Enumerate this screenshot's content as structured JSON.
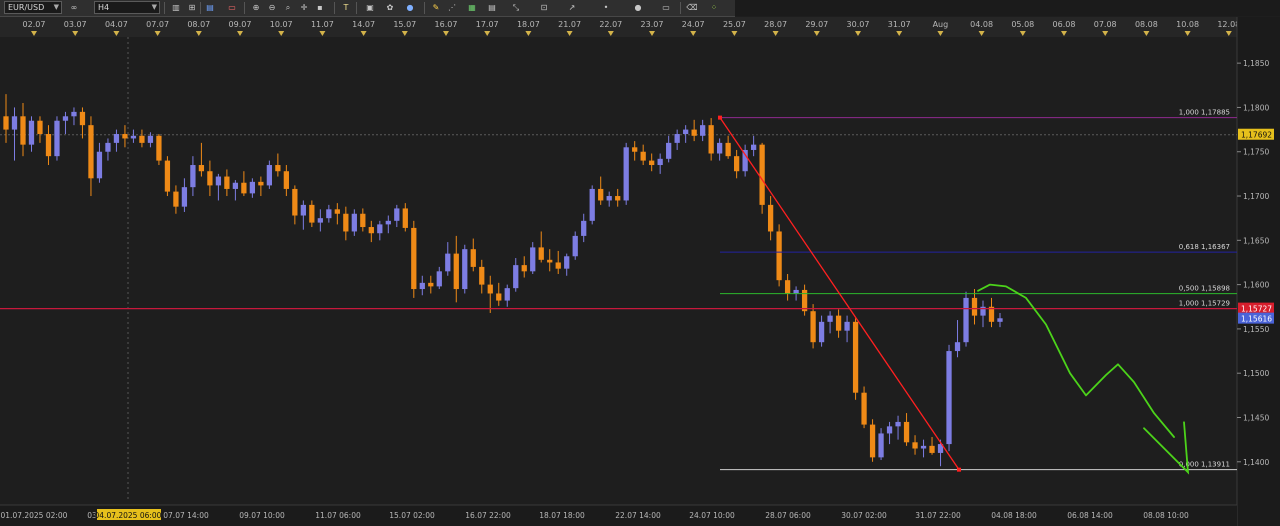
{
  "toolbar": {
    "symbol": "EUR/USD",
    "timeframe": "H4",
    "icons": [
      "link-icon",
      "candles-icon",
      "bars-icon",
      "line-chart-icon",
      "zoom-in-icon",
      "zoom-out-icon",
      "search-icon",
      "crosshair-icon",
      "cursor-icon",
      "text-tool-icon",
      "note-icon",
      "color-palette-icon",
      "globe-icon",
      "pencil-icon",
      "trend-tool-icon",
      "window-icon",
      "fibonacci-icon",
      "shapes-icon",
      "channel-icon",
      "sphere-icon",
      "arrow-icon",
      "eraser-icon",
      "indicators-icon"
    ]
  },
  "chart": {
    "colors": {
      "background": "#1e1e1e",
      "bull": "#7d7de3",
      "bear": "#ef8a17",
      "trend_line": "#ff2020",
      "support_line": "#c8193c",
      "green_drawing": "#4cd31a",
      "fib_1": "#8e2a8e",
      "fib_0618": "#2323a0",
      "fib_0500": "#2cb82c",
      "fib_0": "#cfcfcf"
    },
    "top_dates": [
      "02.07",
      "03.07",
      "04.07",
      "07.07",
      "08.07",
      "09.07",
      "10.07",
      "11.07",
      "14.07",
      "15.07",
      "16.07",
      "17.07",
      "18.07",
      "21.07",
      "22.07",
      "23.07",
      "24.07",
      "25.07",
      "28.07",
      "29.07",
      "30.07",
      "31.07",
      "Aug",
      "04.08",
      "05.08",
      "06.08",
      "07.08",
      "08.08",
      "10.08",
      "12.08"
    ],
    "bottom_dates": [
      "01.07.2025 02:00",
      "03",
      "04.07.2025 06:00",
      "07.07 14:00",
      "09.07 10:00",
      "11.07 06:00",
      "15.07 02:00",
      "16.07 22:00",
      "18.07 18:00",
      "22.07 14:00",
      "24.07 10:00",
      "28.07 06:00",
      "30.07 02:00",
      "31.07 22:00",
      "04.08 18:00",
      "06.08 14:00",
      "08.08 10:00"
    ],
    "price_labels": [
      "1,18500",
      "1,1800",
      "1,1750",
      "1,1700",
      "1,1650",
      "1,1600",
      "1,1550",
      "1,1500",
      "1,1450",
      "1,1400",
      "1,1850"
    ],
    "y_axis": [
      "1,1850",
      "1,1800",
      "1,1750",
      "1,1700",
      "1,1650",
      "1,1600",
      "1,1550",
      "1,1500",
      "1,1450",
      "1,1400"
    ],
    "price_tags": {
      "high_marker": "1,17692",
      "line_price": "1,15727",
      "current_price": "1,15616"
    },
    "fib_levels": [
      {
        "label": "1,000 1,17885",
        "price": 1.17885
      },
      {
        "label": "0,618 1,16367",
        "price": 1.16367
      },
      {
        "label": "0,500 1,15898",
        "price": 1.15898
      },
      {
        "label": "0,000 1,13911",
        "price": 1.13911
      }
    ],
    "support_label": "1,000 1,15729",
    "support_price": 1.15729,
    "high_marker_price": 1.17692,
    "current_price": 1.15616,
    "candles": [
      [
        1.179,
        1.1815,
        1.176,
        1.1775
      ],
      [
        1.1775,
        1.18,
        1.174,
        1.179
      ],
      [
        1.179,
        1.1805,
        1.1745,
        1.1758
      ],
      [
        1.1758,
        1.179,
        1.175,
        1.1785
      ],
      [
        1.1785,
        1.179,
        1.176,
        1.177
      ],
      [
        1.177,
        1.178,
        1.1735,
        1.1745
      ],
      [
        1.1745,
        1.179,
        1.174,
        1.1785
      ],
      [
        1.1785,
        1.1795,
        1.177,
        1.179
      ],
      [
        1.179,
        1.18,
        1.178,
        1.1795
      ],
      [
        1.1795,
        1.18,
        1.1765,
        1.178
      ],
      [
        1.178,
        1.179,
        1.17,
        1.172
      ],
      [
        1.172,
        1.176,
        1.1715,
        1.175
      ],
      [
        1.175,
        1.1765,
        1.174,
        1.176
      ],
      [
        1.176,
        1.1775,
        1.175,
        1.177
      ],
      [
        1.177,
        1.178,
        1.1755,
        1.1765
      ],
      [
        1.1765,
        1.1775,
        1.176,
        1.1768
      ],
      [
        1.1768,
        1.1775,
        1.1755,
        1.176
      ],
      [
        1.176,
        1.1772,
        1.1755,
        1.1768
      ],
      [
        1.1768,
        1.177,
        1.1735,
        1.174
      ],
      [
        1.174,
        1.1745,
        1.17,
        1.1705
      ],
      [
        1.1705,
        1.1712,
        1.168,
        1.1688
      ],
      [
        1.1688,
        1.172,
        1.1682,
        1.171
      ],
      [
        1.171,
        1.1745,
        1.17,
        1.1735
      ],
      [
        1.1735,
        1.176,
        1.1722,
        1.1728
      ],
      [
        1.1728,
        1.174,
        1.17,
        1.1712
      ],
      [
        1.1712,
        1.1725,
        1.1695,
        1.1722
      ],
      [
        1.1722,
        1.173,
        1.17,
        1.1708
      ],
      [
        1.1708,
        1.1718,
        1.1695,
        1.1715
      ],
      [
        1.1715,
        1.1728,
        1.17,
        1.1703
      ],
      [
        1.1703,
        1.172,
        1.1698,
        1.1716
      ],
      [
        1.1716,
        1.1722,
        1.17,
        1.1712
      ],
      [
        1.1712,
        1.174,
        1.1708,
        1.1735
      ],
      [
        1.1735,
        1.1748,
        1.1722,
        1.1728
      ],
      [
        1.1728,
        1.1735,
        1.17,
        1.1708
      ],
      [
        1.1708,
        1.1712,
        1.1668,
        1.1678
      ],
      [
        1.1678,
        1.1695,
        1.1662,
        1.169
      ],
      [
        1.169,
        1.1695,
        1.1665,
        1.167
      ],
      [
        1.167,
        1.1685,
        1.166,
        1.1675
      ],
      [
        1.1675,
        1.169,
        1.167,
        1.1685
      ],
      [
        1.1685,
        1.1692,
        1.1668,
        1.168
      ],
      [
        1.168,
        1.1688,
        1.165,
        1.166
      ],
      [
        1.166,
        1.1685,
        1.1655,
        1.168
      ],
      [
        1.168,
        1.1686,
        1.166,
        1.1665
      ],
      [
        1.1665,
        1.1672,
        1.1648,
        1.1658
      ],
      [
        1.1658,
        1.1672,
        1.165,
        1.1668
      ],
      [
        1.1668,
        1.1678,
        1.1658,
        1.1672
      ],
      [
        1.1672,
        1.169,
        1.1665,
        1.1686
      ],
      [
        1.1686,
        1.1692,
        1.166,
        1.1664
      ],
      [
        1.1664,
        1.1672,
        1.1585,
        1.1595
      ],
      [
        1.1595,
        1.161,
        1.1588,
        1.1602
      ],
      [
        1.1602,
        1.161,
        1.159,
        1.1598
      ],
      [
        1.1598,
        1.162,
        1.1595,
        1.1615
      ],
      [
        1.1615,
        1.1648,
        1.161,
        1.1635
      ],
      [
        1.1635,
        1.1655,
        1.158,
        1.1595
      ],
      [
        1.1595,
        1.1645,
        1.159,
        1.164
      ],
      [
        1.164,
        1.1652,
        1.1615,
        1.162
      ],
      [
        1.162,
        1.1628,
        1.159,
        1.16
      ],
      [
        1.16,
        1.161,
        1.1568,
        1.159
      ],
      [
        1.159,
        1.1602,
        1.1576,
        1.1582
      ],
      [
        1.1582,
        1.16,
        1.1575,
        1.1596
      ],
      [
        1.1596,
        1.163,
        1.1592,
        1.1622
      ],
      [
        1.1622,
        1.1632,
        1.1608,
        1.1615
      ],
      [
        1.1615,
        1.1648,
        1.1612,
        1.1642
      ],
      [
        1.1642,
        1.166,
        1.1625,
        1.1628
      ],
      [
        1.1628,
        1.164,
        1.1615,
        1.1625
      ],
      [
        1.1625,
        1.1638,
        1.1612,
        1.1618
      ],
      [
        1.1618,
        1.1635,
        1.161,
        1.1632
      ],
      [
        1.1632,
        1.166,
        1.1628,
        1.1655
      ],
      [
        1.1655,
        1.168,
        1.1648,
        1.1672
      ],
      [
        1.1672,
        1.1712,
        1.1668,
        1.1708
      ],
      [
        1.1708,
        1.1722,
        1.169,
        1.1695
      ],
      [
        1.1695,
        1.1705,
        1.1688,
        1.17
      ],
      [
        1.17,
        1.1708,
        1.1688,
        1.1695
      ],
      [
        1.1695,
        1.176,
        1.169,
        1.1755
      ],
      [
        1.1755,
        1.1762,
        1.174,
        1.175
      ],
      [
        1.175,
        1.1758,
        1.1735,
        1.174
      ],
      [
        1.174,
        1.1748,
        1.1728,
        1.1735
      ],
      [
        1.1735,
        1.1748,
        1.1725,
        1.1742
      ],
      [
        1.1742,
        1.1768,
        1.1738,
        1.176
      ],
      [
        1.176,
        1.1775,
        1.1752,
        1.177
      ],
      [
        1.177,
        1.178,
        1.176,
        1.1775
      ],
      [
        1.1775,
        1.1786,
        1.1762,
        1.1768
      ],
      [
        1.1768,
        1.1786,
        1.1762,
        1.178
      ],
      [
        1.178,
        1.1788,
        1.174,
        1.1748
      ],
      [
        1.1748,
        1.1765,
        1.174,
        1.176
      ],
      [
        1.176,
        1.1768,
        1.1742,
        1.1745
      ],
      [
        1.1745,
        1.1752,
        1.172,
        1.1728
      ],
      [
        1.1728,
        1.1758,
        1.1722,
        1.1752
      ],
      [
        1.1752,
        1.1768,
        1.1745,
        1.1758
      ],
      [
        1.1758,
        1.176,
        1.168,
        1.169
      ],
      [
        1.169,
        1.17,
        1.165,
        1.166
      ],
      [
        1.166,
        1.1668,
        1.1598,
        1.1605
      ],
      [
        1.1605,
        1.1612,
        1.1582,
        1.159
      ],
      [
        1.159,
        1.1598,
        1.1582,
        1.1594
      ],
      [
        1.1594,
        1.16,
        1.1565,
        1.157
      ],
      [
        1.157,
        1.1578,
        1.1528,
        1.1535
      ],
      [
        1.1535,
        1.1565,
        1.153,
        1.1558
      ],
      [
        1.1558,
        1.157,
        1.1545,
        1.1565
      ],
      [
        1.1565,
        1.1572,
        1.154,
        1.1548
      ],
      [
        1.1548,
        1.1565,
        1.1535,
        1.1558
      ],
      [
        1.1558,
        1.1562,
        1.147,
        1.1478
      ],
      [
        1.1478,
        1.1485,
        1.1438,
        1.1442
      ],
      [
        1.1442,
        1.1448,
        1.14,
        1.1405
      ],
      [
        1.1405,
        1.1438,
        1.1402,
        1.1432
      ],
      [
        1.1432,
        1.1445,
        1.142,
        1.144
      ],
      [
        1.144,
        1.1452,
        1.1425,
        1.1445
      ],
      [
        1.1445,
        1.1455,
        1.1418,
        1.1422
      ],
      [
        1.1422,
        1.143,
        1.1408,
        1.1415
      ],
      [
        1.1415,
        1.1425,
        1.1405,
        1.1418
      ],
      [
        1.1418,
        1.1428,
        1.1408,
        1.141
      ],
      [
        1.141,
        1.1425,
        1.1395,
        1.142
      ],
      [
        1.142,
        1.1532,
        1.1412,
        1.1525
      ],
      [
        1.1525,
        1.156,
        1.1518,
        1.1535
      ],
      [
        1.1535,
        1.1592,
        1.153,
        1.1585
      ],
      [
        1.1585,
        1.1595,
        1.1555,
        1.1565
      ],
      [
        1.1565,
        1.1582,
        1.1552,
        1.1575
      ],
      [
        1.1575,
        1.1585,
        1.1552,
        1.1558
      ],
      [
        1.1558,
        1.1568,
        1.1552,
        1.1562
      ]
    ],
    "green_path": [
      [
        1.1593,
        0
      ],
      [
        1.16,
        6
      ],
      [
        1.1598,
        14
      ],
      [
        1.1585,
        24
      ],
      [
        1.1555,
        34
      ],
      [
        1.15,
        46
      ],
      [
        1.1475,
        54
      ],
      [
        1.1498,
        64
      ],
      [
        1.151,
        70
      ],
      [
        1.149,
        78
      ],
      [
        1.1455,
        88
      ],
      [
        1.1428,
        98
      ]
    ]
  }
}
